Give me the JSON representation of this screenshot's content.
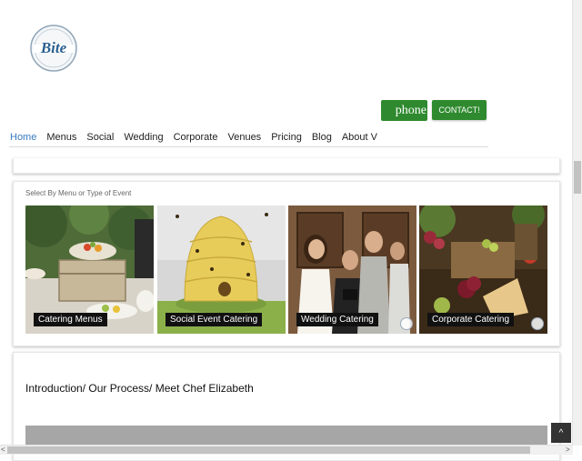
{
  "header": {
    "logo_text": "Bite",
    "phone_label": "phone",
    "contact_label": "CONTACT!"
  },
  "nav": {
    "items": [
      "Home",
      "Menus",
      "Social",
      "Wedding",
      "Corporate",
      "Venues",
      "Pricing",
      "Blog",
      "About V"
    ]
  },
  "events": {
    "label": "Select By Menu or Type of Event",
    "tiles": [
      {
        "caption": "Catering Menus"
      },
      {
        "caption": "Social Event Catering"
      },
      {
        "caption": "Wedding Catering"
      },
      {
        "caption": "Corporate Catering"
      }
    ]
  },
  "intro": {
    "title": "Introduction/ Our Process/ Meet Chef Elizabeth"
  },
  "controls": {
    "to_top": "^",
    "scroll_left": "<",
    "scroll_right": ">"
  },
  "colors": {
    "accent_green": "#2f8a2f",
    "nav_active": "#3a7bbf",
    "logo_blue": "#2a5f8f"
  }
}
